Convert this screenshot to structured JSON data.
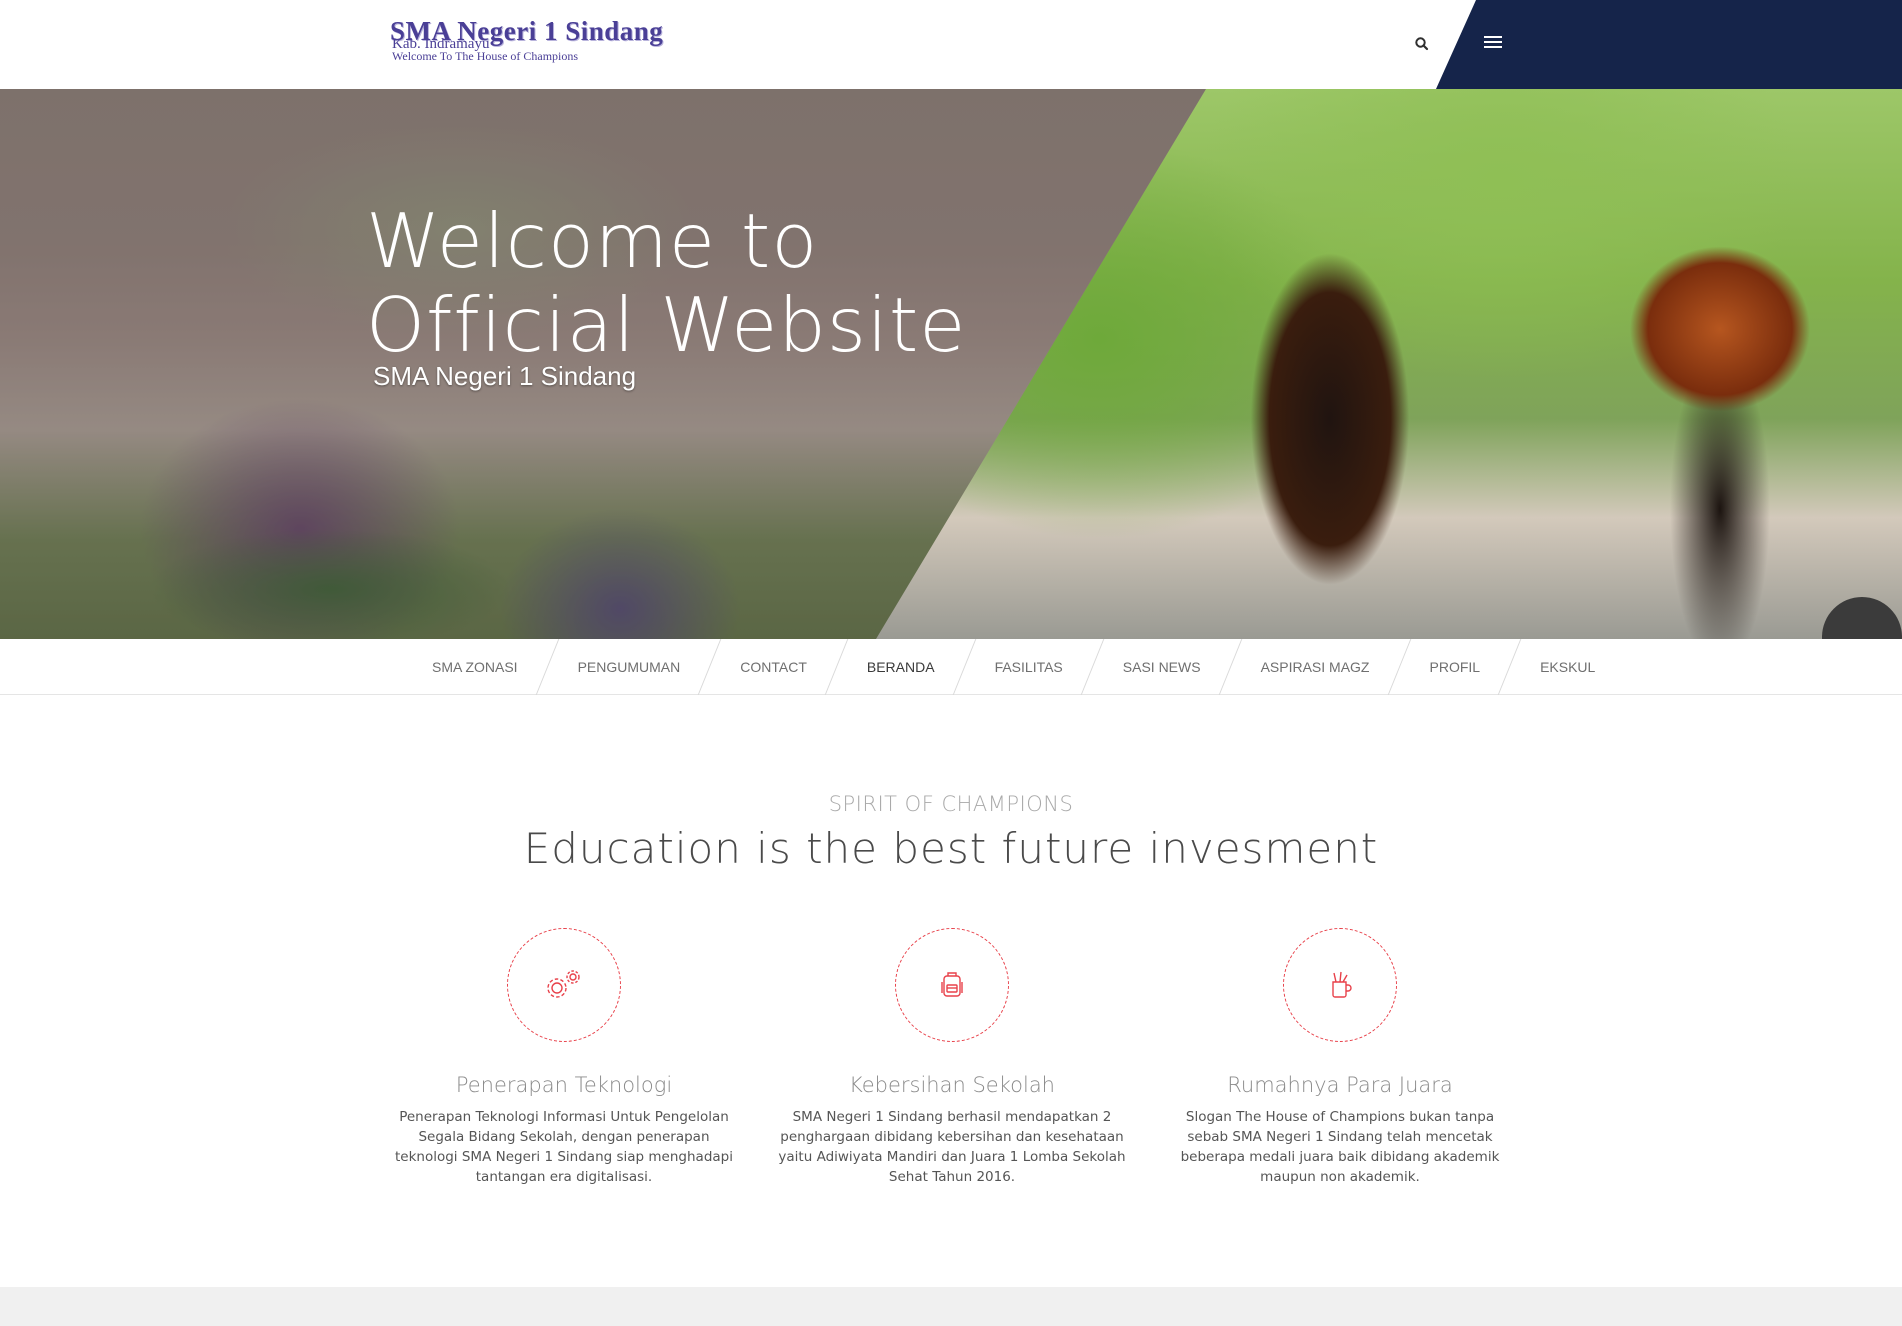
{
  "header": {
    "logo": {
      "title": "SMA Negeri 1 Sindang",
      "subtitle": "Kab. Indramayu",
      "tagline": "Welcome To The House of Champions"
    },
    "search_icon": "search-icon",
    "menu_icon": "hamburger-menu-icon",
    "colors": {
      "nav_panel": "#15244a"
    }
  },
  "hero": {
    "title_line1": "Welcome to",
    "title_line2": "Official Website",
    "subtitle": "SMA Negeri 1 Sindang"
  },
  "nav": {
    "items": [
      {
        "label": "SMA ZONASI"
      },
      {
        "label": "PENGUMUMAN"
      },
      {
        "label": "CONTACT"
      },
      {
        "label": "BERANDA",
        "active": true
      },
      {
        "label": "FASILITAS"
      },
      {
        "label": "SASI NEWS"
      },
      {
        "label": "ASPIRASI MAGZ"
      },
      {
        "label": "PROFIL"
      },
      {
        "label": "EKSKUL"
      }
    ]
  },
  "section": {
    "kicker": "SPIRIT OF CHAMPIONS",
    "heading": "Education is the best future invesment"
  },
  "features": [
    {
      "icon": "gears-icon",
      "title": "Penerapan Teknologi",
      "text": "Penerapan Teknologi Informasi Untuk Pengelolan Segala Bidang Sekolah, dengan penerapan teknologi SMA Negeri 1 Sindang siap menghadapi tantangan era digitalisasi."
    },
    {
      "icon": "backpack-icon",
      "title": "Kebersihan Sekolah",
      "text": "SMA Negeri 1 Sindang berhasil mendapatkan 2 penghargaan dibidang kebersihan dan kesehataan yaitu Adiwiyata Mandiri dan Juara 1 Lomba Sekolah Sehat Tahun 2016."
    },
    {
      "icon": "pencil-cup-icon",
      "title": "Rumahnya Para Juara",
      "text": "Slogan The House of Champions bukan tanpa sebab SMA Negeri 1 Sindang telah mencetak beberapa medali juara baik dibidang akademik maupun non akademik."
    }
  ],
  "colors": {
    "accent": "#e8414a"
  }
}
